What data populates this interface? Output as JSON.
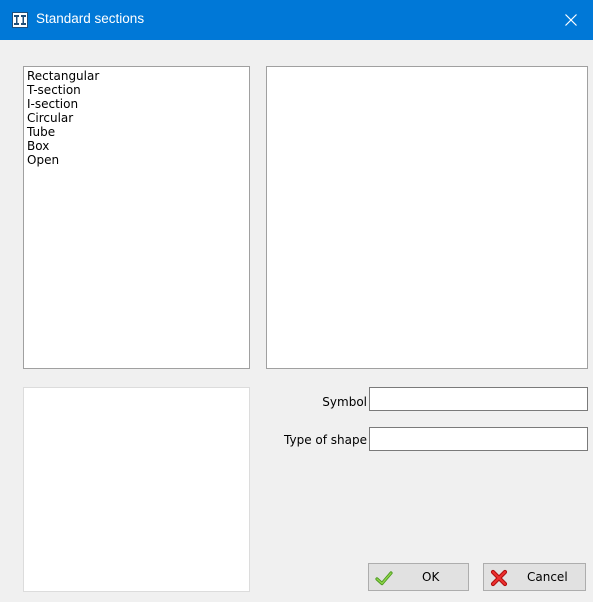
{
  "window": {
    "title": "Standard sections",
    "icon": "section-icon",
    "close_icon": "close-icon",
    "title_bar_color": "#0078d7"
  },
  "section_types": {
    "items": [
      "Rectangular",
      "T-section",
      "I-section",
      "Circular",
      "Tube",
      "Box",
      "Open"
    ]
  },
  "form": {
    "symbol_label": "Symbol",
    "symbol_value": "",
    "type_label": "Type of shape",
    "type_value": ""
  },
  "buttons": {
    "ok_label": "OK",
    "ok_icon": "checkmark-icon",
    "cancel_label": "Cancel",
    "cancel_icon": "red-x-icon"
  }
}
